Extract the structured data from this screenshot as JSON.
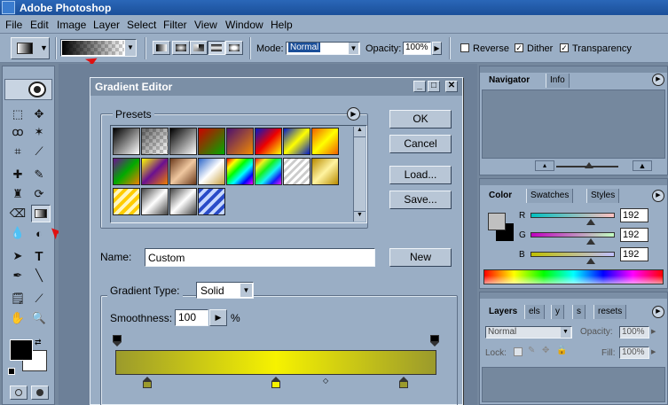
{
  "app": {
    "title": "Adobe Photoshop"
  },
  "menu": [
    "File",
    "Edit",
    "Image",
    "Layer",
    "Select",
    "Filter",
    "View",
    "Window",
    "Help"
  ],
  "options": {
    "mode_label": "Mode:",
    "mode_value": "Normal",
    "opacity_label": "Opacity:",
    "opacity_value": "100%",
    "reverse_label": "Reverse",
    "dither_label": "Dither",
    "transparency_label": "Transparency",
    "reverse_checked": false,
    "dither_checked": true,
    "transparency_checked": true
  },
  "dialog": {
    "title": "Gradient Editor",
    "presets_label": "Presets",
    "ok_label": "OK",
    "cancel_label": "Cancel",
    "load_label": "Load...",
    "save_label": "Save...",
    "name_label": "Name:",
    "name_value": "Custom",
    "new_label": "New",
    "gradient_type_label": "Gradient Type:",
    "gradient_type_value": "Solid",
    "smoothness_label": "Smoothness:",
    "smoothness_value": "100",
    "smoothness_unit": "%",
    "gradient_colors": [
      "#9b9a2c",
      "#f6f200",
      "#9b9a2c"
    ]
  },
  "presets": [
    {
      "icon": "black-white-gradient"
    },
    {
      "icon": "transparent-gradient"
    },
    {
      "icon": "black-white-gradient"
    },
    {
      "icon": "red-green-gradient"
    },
    {
      "icon": "violet-orange-gradient"
    },
    {
      "icon": "blue-red-yellow-gradient"
    },
    {
      "icon": "blue-yellow-blue-gradient"
    },
    {
      "icon": "orange-yellow-orange-gradient"
    },
    {
      "icon": "violet-green-orange-gradient"
    },
    {
      "icon": "yellow-violet-orange-gradient"
    },
    {
      "icon": "copper-gradient"
    },
    {
      "icon": "chrome-gradient"
    },
    {
      "icon": "spectrum-gradient"
    },
    {
      "icon": "transparent-rainbow-gradient"
    },
    {
      "icon": "transparent-stripes-gradient"
    },
    {
      "icon": "gold-gradient"
    },
    {
      "icon": "yellow-stripes-gradient"
    },
    {
      "icon": "silver-gradient"
    },
    {
      "icon": "silver-gradient"
    },
    {
      "icon": "blue-stripes-gradient"
    }
  ],
  "panels": {
    "navigator": {
      "tabs": [
        "Navigator",
        "Info"
      ]
    },
    "color": {
      "tabs": [
        "Color",
        "Swatches",
        "Styles"
      ],
      "channels": [
        {
          "label": "R",
          "value": "192"
        },
        {
          "label": "G",
          "value": "192"
        },
        {
          "label": "B",
          "value": "192"
        }
      ]
    },
    "layers": {
      "tabs": [
        "Layers",
        "els",
        "y",
        "s",
        "resets"
      ],
      "blend_mode": "Normal",
      "opacity_label": "Opacity:",
      "opacity_value": "100%",
      "lock_label": "Lock:",
      "fill_label": "Fill:",
      "fill_value": "100%"
    }
  },
  "colors": {
    "foreground": "#000000",
    "background": "#ffffff"
  }
}
